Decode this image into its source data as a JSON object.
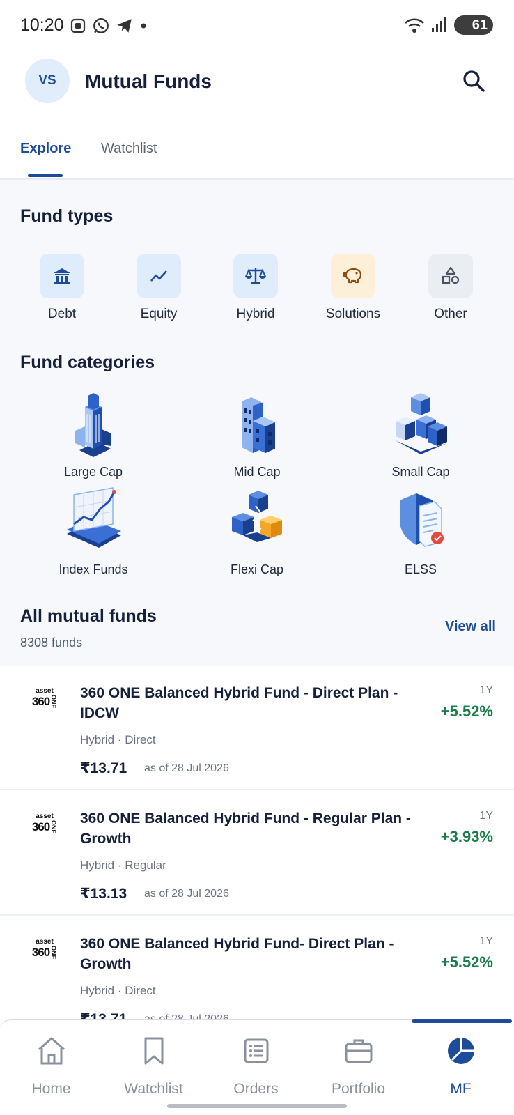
{
  "status": {
    "time": "10:20",
    "battery": "61"
  },
  "header": {
    "avatar": "VS",
    "title": "Mutual Funds"
  },
  "tabs": [
    {
      "label": "Explore"
    },
    {
      "label": "Watchlist"
    }
  ],
  "fund_types": {
    "title": "Fund types",
    "items": [
      {
        "label": "Debt",
        "icon": "bank-icon"
      },
      {
        "label": "Equity",
        "icon": "trend-icon"
      },
      {
        "label": "Hybrid",
        "icon": "scale-icon"
      },
      {
        "label": "Solutions",
        "icon": "piggy-bank-icon"
      },
      {
        "label": "Other",
        "icon": "shapes-icon"
      }
    ]
  },
  "fund_categories": {
    "title": "Fund categories",
    "items": [
      {
        "label": "Large Cap"
      },
      {
        "label": "Mid Cap"
      },
      {
        "label": "Small Cap"
      },
      {
        "label": "Index Funds"
      },
      {
        "label": "Flexi Cap"
      },
      {
        "label": "ELSS"
      }
    ]
  },
  "all_funds": {
    "title": "All mutual funds",
    "count": "8308 funds",
    "view_all": "View all",
    "items": [
      {
        "logo_top": "asset",
        "logo_main": "360",
        "logo_side": "ONE",
        "name": "360 ONE Balanced Hybrid Fund - Direct Plan - IDCW",
        "sub": "Hybrid · Direct",
        "price": "₹13.71",
        "date": "as of 28 Jul 2026",
        "period": "1Y",
        "return": "+5.52%"
      },
      {
        "logo_top": "asset",
        "logo_main": "360",
        "logo_side": "ONE",
        "name": "360 ONE Balanced Hybrid Fund - Regular Plan - Growth",
        "sub": "Hybrid · Regular",
        "price": "₹13.13",
        "date": "as of 28 Jul 2026",
        "period": "1Y",
        "return": "+3.93%"
      },
      {
        "logo_top": "asset",
        "logo_main": "360",
        "logo_side": "ONE",
        "name": "360 ONE Balanced Hybrid Fund- Direct Plan - Growth",
        "sub": "Hybrid · Direct",
        "price": "₹13.71",
        "date": "as of 28 Jul 2026",
        "period": "1Y",
        "return": "+5.52%"
      }
    ]
  },
  "bottom_nav": [
    {
      "label": "Home"
    },
    {
      "label": "Watchlist"
    },
    {
      "label": "Orders"
    },
    {
      "label": "Portfolio"
    },
    {
      "label": "MF"
    }
  ],
  "colors": {
    "accent": "#1d4c9a",
    "positive": "#1c7d4b"
  }
}
